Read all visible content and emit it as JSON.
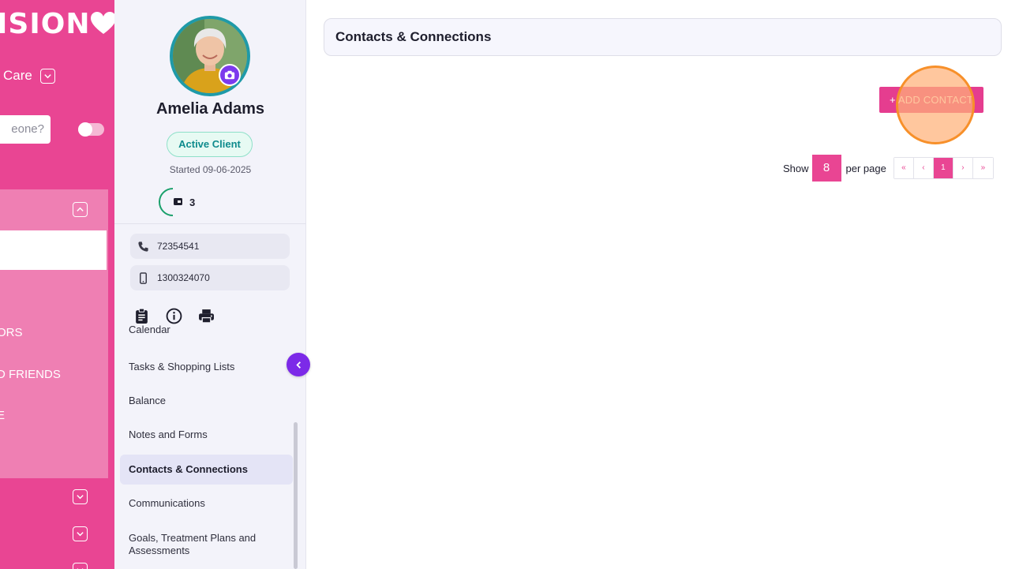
{
  "left_nav": {
    "brand": "ISION",
    "care_label": "Care",
    "search_placeholder": "eone?",
    "menu_items": [
      "ORS",
      "D FRIENDS",
      "E"
    ]
  },
  "profile": {
    "name": "Amelia Adams",
    "status": "Active Client",
    "started": "Started 09-06-2025",
    "budget_count": "3",
    "phone": "72354541",
    "mobile": "1300324070"
  },
  "nav": {
    "items": [
      {
        "label": "Calendar"
      },
      {
        "label": "Tasks & Shopping Lists"
      },
      {
        "label": "Balance"
      },
      {
        "label": "Notes and Forms"
      },
      {
        "label": "Contacts & Connections",
        "active": true
      },
      {
        "label": "Communications"
      },
      {
        "label": "Goals, Treatment Plans and Assessments"
      }
    ]
  },
  "main": {
    "title": "Contacts & Connections",
    "add_button": "+ ADD CONTACT",
    "pagination": {
      "show_label": "Show",
      "per_page_value": "8",
      "per_page_label": "per page",
      "first": "«",
      "prev": "‹",
      "current_page": "1",
      "next": "›",
      "last": "»"
    }
  },
  "colors": {
    "brand_pink": "#e94593",
    "accent_purple": "#7c3aed",
    "active_green": "#0f8b8d"
  }
}
